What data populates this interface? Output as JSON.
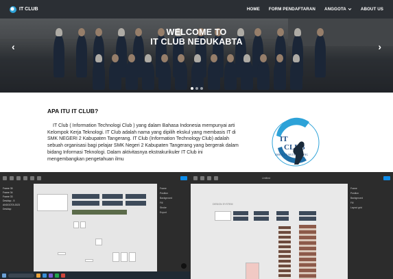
{
  "navbar": {
    "brand": "IT CLUB",
    "links": [
      {
        "label": "HOME"
      },
      {
        "label": "FORM PENDAFTARAN"
      },
      {
        "label": "ANGGOTA"
      },
      {
        "label": "ABOUT US"
      }
    ],
    "dropdown_icon": "chevron-down-icon"
  },
  "hero": {
    "title_line1": "WELCOME TO",
    "title_line2": "IT CLUB NEDUKABTA",
    "prev": "‹",
    "next": "›",
    "slide_count": 3,
    "active_slide": 1
  },
  "about": {
    "title": "APA ITU IT CLUB?",
    "text": "IT Club ( Information Technologi Club ) yang dalam Bahasa Indonesia mempunyai arti Kelompok Kerja Teknologi. IT Club adalah nama yang dipilih ekskul yang membasis IT di SMK NEGERI 2 Kabupaten Tangerang. IT Club (Information Technology Club) adalah sebuah organisasi bagi pelajar SMK Negeri 2 Kabupaten Tangerang yang bergerak dalam bidang Informasi Teknologi. Dalam aktivitasnya ekstrakurikuler IT Club ini mengembangkan pengetahuan ilmu",
    "logo": {
      "line1": "IT",
      "line2": "CLUB",
      "ring_text": "SMK N 2 KAB.TANGERANG"
    }
  },
  "editor_left": {
    "layers": [
      "Frame 35",
      "Frame 34",
      "Frame 33",
      "Desktop - 5",
      "ANGGOTA 2023",
      "Desktop"
    ],
    "props": [
      "Frame",
      "Position",
      "Background",
      "Fill",
      "Stroke",
      "Export"
    ]
  },
  "editor_right": {
    "filename": "Untitled",
    "canvas_label": "DESIGN SYSTEM",
    "props": [
      "Frame",
      "Position",
      "Background",
      "Fill",
      "Layout grid"
    ]
  },
  "colors": {
    "navbar": "#2b2f34",
    "accent": "#2da2d8",
    "editor_bg": "#1e1e1e"
  }
}
